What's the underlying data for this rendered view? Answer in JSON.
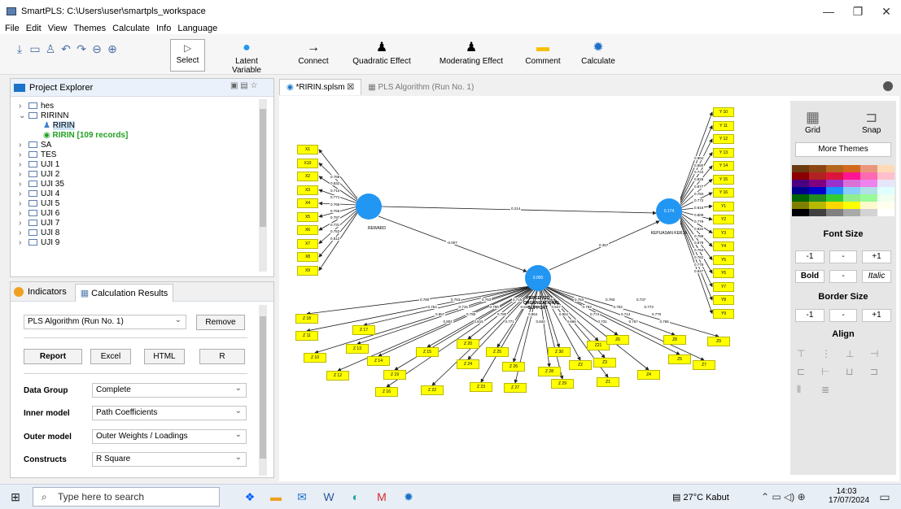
{
  "window": {
    "title": "SmartPLS: C:\\Users\\user\\smartpls_workspace",
    "min": "—",
    "max": "❐",
    "close": "✕"
  },
  "menu": [
    "File",
    "Edit",
    "View",
    "Themes",
    "Calculate",
    "Info",
    "Language"
  ],
  "toolbar": {
    "select": "Select",
    "latent": "Latent Variable",
    "connect": "Connect",
    "quadratic": "Quadratic Effect",
    "moderating": "Moderating Effect",
    "comment": "Comment",
    "calculate": "Calculate"
  },
  "project_explorer": {
    "title": "Project Explorer",
    "items": [
      {
        "chev": "›",
        "name": "hes"
      },
      {
        "chev": "⌄",
        "name": "RIRINN"
      },
      {
        "chev": "",
        "name": "RIRIN",
        "sub": true,
        "kind": "model"
      },
      {
        "chev": "",
        "name": "RIRIN [109 records]",
        "sub": true,
        "kind": "data"
      },
      {
        "chev": "›",
        "name": "SA"
      },
      {
        "chev": "›",
        "name": "TES"
      },
      {
        "chev": "›",
        "name": "UJI 1"
      },
      {
        "chev": "›",
        "name": "UJI 2"
      },
      {
        "chev": "›",
        "name": "UJI 35"
      },
      {
        "chev": "›",
        "name": "UJI 4"
      },
      {
        "chev": "›",
        "name": "UJI 5"
      },
      {
        "chev": "›",
        "name": "UJI 6"
      },
      {
        "chev": "›",
        "name": "UJI 7"
      },
      {
        "chev": "›",
        "name": "UJI 8"
      },
      {
        "chev": "›",
        "name": "UJI 9"
      }
    ]
  },
  "results_panel": {
    "tab_indicators": "Indicators",
    "tab_calc": "Calculation Results",
    "run": "PLS Algorithm (Run No. 1)",
    "remove": "Remove",
    "report": "Report",
    "excel": "Excel",
    "html": "HTML",
    "r": "R",
    "rows": [
      {
        "label": "Data Group",
        "value": "Complete"
      },
      {
        "label": "Inner model",
        "value": "Path Coefficients"
      },
      {
        "label": "Outer model",
        "value": "Outer Weights / Loadings"
      },
      {
        "label": "Constructs",
        "value": "R Square"
      }
    ]
  },
  "editor_tabs": {
    "active": "*RIRIN.splsm ☒",
    "inactive": "PLS Algorithm (Run No. 1)"
  },
  "model": {
    "reward": {
      "name": "REWARD",
      "value": ""
    },
    "kepuasan": {
      "name": "KEPUASAN KERJA",
      "value": "0.174"
    },
    "pos": {
      "name": "PERCEIVED ORGANIZATIONAL SUPPORT",
      "value": "0.000"
    },
    "paths": {
      "reward_kepuasan": "0.214",
      "reward_pos": "-0.007",
      "pos_kepuasan": "0.357"
    },
    "x_items": [
      "X1",
      "X10",
      "X2",
      "X3",
      "X4",
      "X5",
      "X6",
      "X7",
      "X8",
      "X9"
    ],
    "x_loadings": [
      "0.768",
      "0.832",
      "0.710",
      "0.771",
      "0.766",
      "0.766",
      "0.797",
      "0.731",
      "0.752",
      "0.812"
    ],
    "y_items": [
      "Y 10",
      "Y 11",
      "Y 12",
      "Y 13",
      "Y 14",
      "Y 15",
      "Y 16",
      "Y1",
      "Y2",
      "Y3",
      "Y4",
      "Y5",
      "Y6",
      "Y7",
      "Y8",
      "Y9"
    ],
    "y_loadings": [
      "0.804",
      "0.850",
      "0.722",
      "0.826",
      "0.877",
      "0.784",
      "0.772",
      "0.815",
      "0.809",
      "0.779",
      "0.822",
      "0.788",
      "0.879",
      "0.764",
      "0.762",
      "0.778",
      "0.847"
    ],
    "z_items": [
      "Z 18",
      "Z 11",
      "Z 10",
      "Z 17",
      "Z 12",
      "Z 13",
      "Z 14",
      "Z 15",
      "Z 19",
      "Z 16",
      "Z 20",
      "Z 22",
      "Z 24",
      "Z 23",
      "Z 25",
      "Z 26",
      "Z 27",
      "Z 28",
      "Z 29",
      "Z 30",
      "Z2",
      "Z21",
      "Z1",
      "Z3",
      "Z6",
      "Z4",
      "Z8",
      "Z5",
      "Z7",
      "Z9"
    ],
    "z_loadings": [
      "0.780",
      "0.754",
      "0.857",
      "0.802",
      "0.763",
      "0.716",
      "0.790",
      "0.815",
      "0.763",
      "0.798",
      "0.780",
      "0.771",
      "0.715",
      "0.840",
      "0.864",
      "0.840",
      "0.795",
      "0.847",
      "0.861",
      "0.866",
      "0.753",
      "0.783",
      "0.774",
      "0.731",
      "0.783",
      "0.753",
      "0.714",
      "0.757",
      "0.737",
      "0.773",
      "0.770",
      "0.765"
    ]
  },
  "right_panel": {
    "grid": "Grid",
    "snap": "Snap",
    "more_themes": "More Themes",
    "font_size": "Font Size",
    "minus": "-1",
    "dash": "-",
    "plus": "+1",
    "bold": "Bold",
    "italic": "Italic",
    "border_size": "Border Size",
    "align": "Align",
    "palette": [
      "#6b3a10",
      "#8b4513",
      "#b5651d",
      "#d2691e",
      "#e9967a",
      "#ffdab9",
      "#8b0000",
      "#b22222",
      "#dc143c",
      "#ff1493",
      "#ff69b4",
      "#ffc0cb",
      "#4b0082",
      "#800080",
      "#9932cc",
      "#da70d6",
      "#ee82ee",
      "#e6e6fa",
      "#00008b",
      "#0000cd",
      "#1e90ff",
      "#87cefa",
      "#b0e0e6",
      "#e0ffff",
      "#006400",
      "#228b22",
      "#32cd32",
      "#90ee90",
      "#98fb98",
      "#f0fff0",
      "#808000",
      "#b8b800",
      "#ffd700",
      "#ffff00",
      "#fffacd",
      "#fffff0",
      "#000000",
      "#404040",
      "#808080",
      "#a9a9a9",
      "#d3d3d3",
      "#ffffff"
    ]
  },
  "taskbar": {
    "search": "Type here to search",
    "weather": "27°C Kabut",
    "time": "14:03",
    "date": "17/07/2024"
  }
}
